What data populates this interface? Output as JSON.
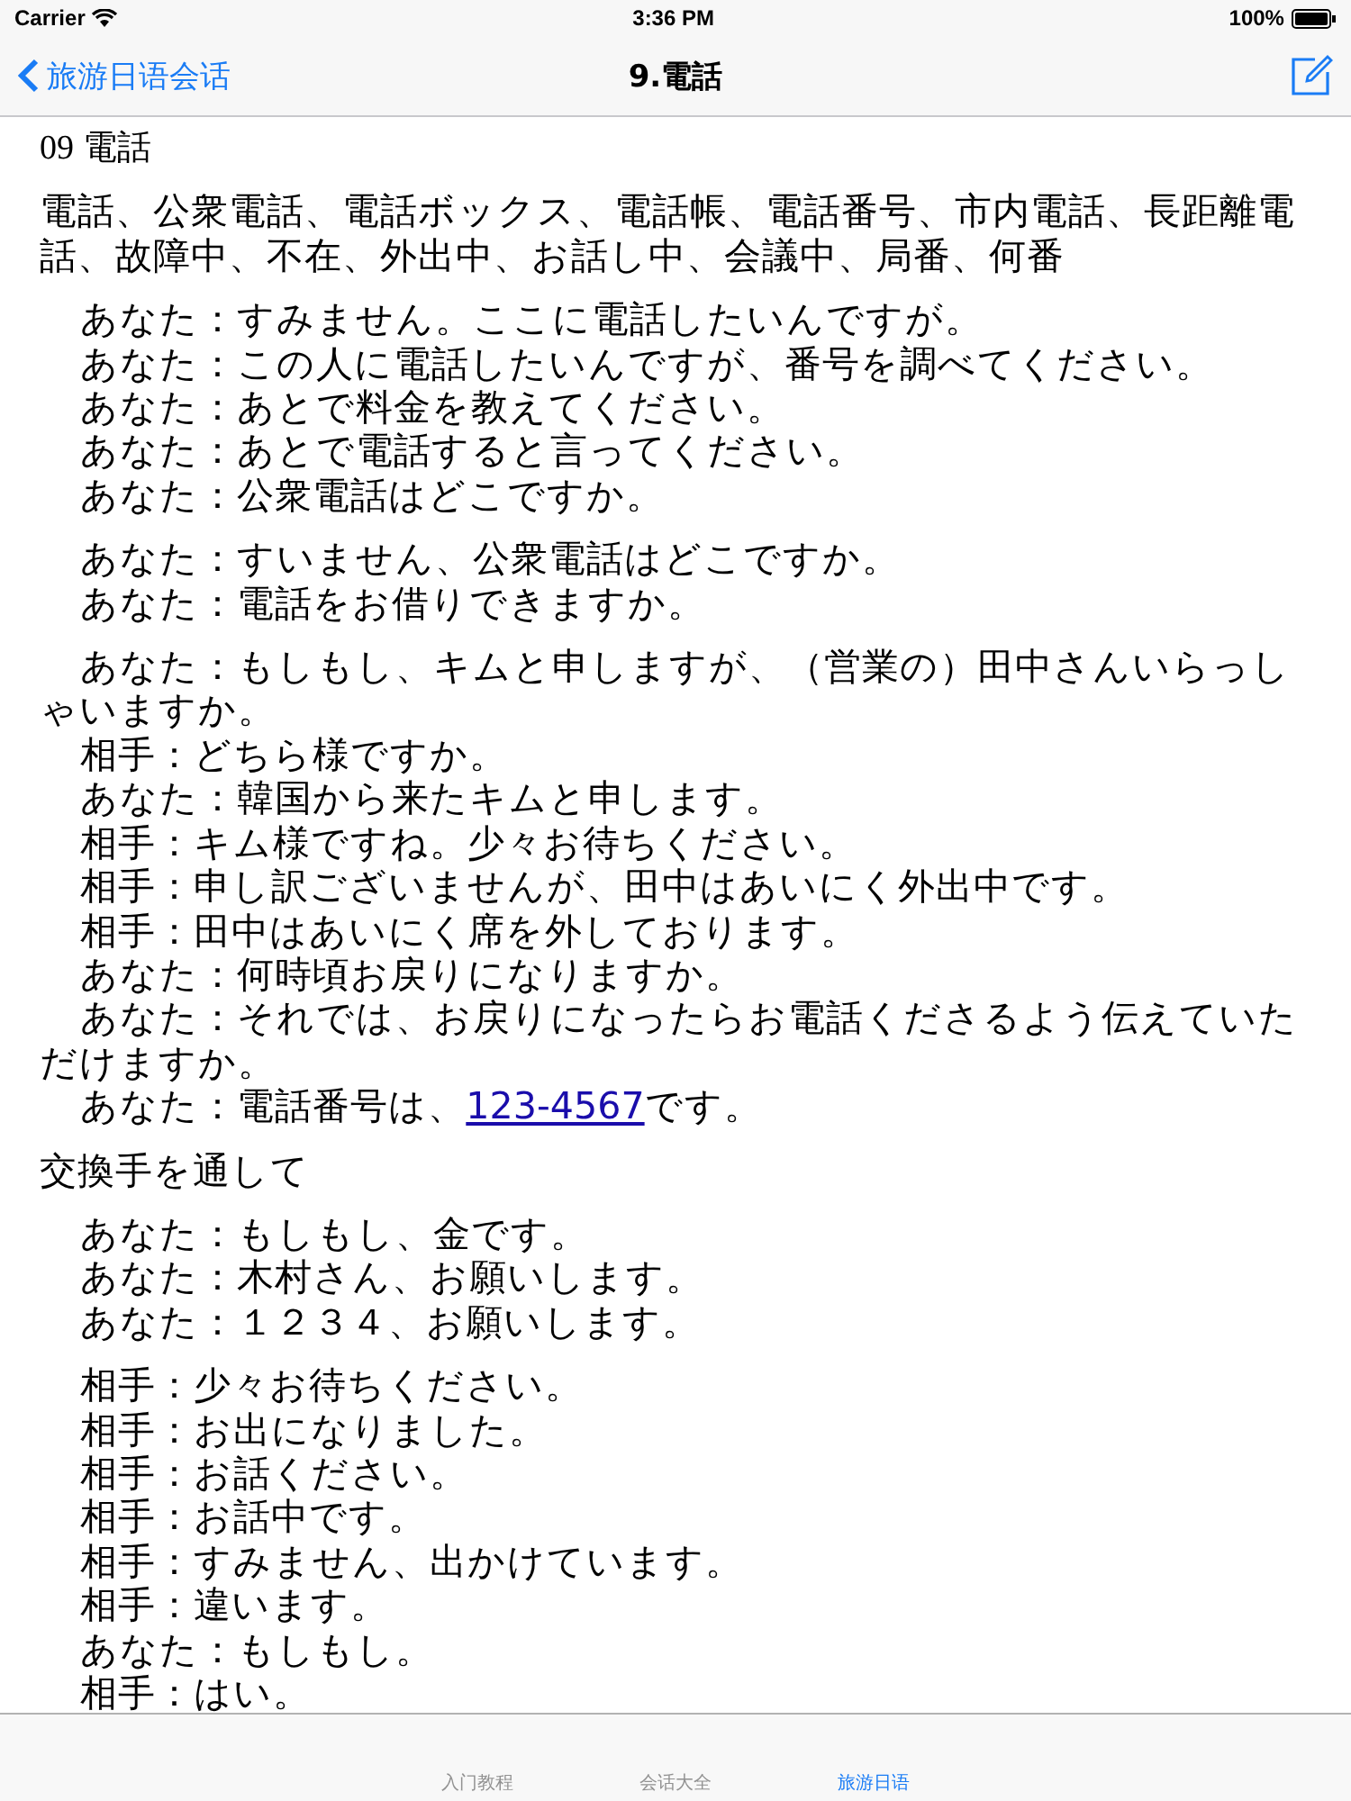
{
  "status_bar": {
    "carrier": "Carrier",
    "time": "3:36 PM",
    "battery": "100%"
  },
  "nav_bar": {
    "back": "旅游日语会话",
    "title": "9.電話"
  },
  "content": {
    "heading": "09 電話",
    "blocks": [
      {
        "kind": "plain",
        "lines": [
          "電話、公衆電話、電話ボックス、電話帳、電話番号、市内電話、長距離電話、故障中、不在、外出中、お話し中、会議中、局番、何番"
        ]
      },
      {
        "kind": "dialogue",
        "lines": [
          "あなた：すみません。ここに電話したいんですが。",
          "あなた：この人に電話したいんですが、番号を調べてください。",
          "あなた：あとで料金を教えてください。",
          "あなた：あとで電話すると言ってください。",
          "あなた：公衆電話はどこですか。"
        ]
      },
      {
        "kind": "dialogue",
        "lines": [
          "あなた：すいません、公衆電話はどこですか。",
          "あなた：電話をお借りできますか。"
        ]
      },
      {
        "kind": "dialogue",
        "lines": [
          "あなた：もしもし、キムと申しますが、（営業の）田中さんいらっしゃいますか。",
          "相手：どちら様ですか。",
          "あなた：韓国から来たキムと申します。",
          "相手：キム様ですね。少々お待ちください。",
          "相手：申し訳ございませんが、田中はあいにく外出中です。",
          "相手：田中はあいにく席を外しております。",
          "あなた：何時頃お戻りになりますか。",
          "あなた：それでは、お戻りになったらお電話くださるよう伝えていただけますか。",
          {
            "text": "あなた：電話番号は、",
            "link": "123-4567",
            "after": "です。"
          }
        ]
      },
      {
        "kind": "plain",
        "lines": [
          "交換手を通して"
        ]
      },
      {
        "kind": "dialogue",
        "lines": [
          "あなた：もしもし、金です。",
          "あなた：木村さん、お願いします。",
          "あなた：１２３４、お願いします。"
        ]
      },
      {
        "kind": "dialogue",
        "lines": [
          "相手：少々お待ちください。",
          "相手：お出になりました。",
          "相手：お話ください。",
          "相手：お話中です。",
          "相手：すみません、出かけています。",
          "相手：違います。",
          "あなた：もしもし。",
          "相手：はい。"
        ]
      }
    ]
  },
  "tab_bar": [
    {
      "label": "入门教程",
      "selected": false
    },
    {
      "label": "会话大全",
      "selected": false
    },
    {
      "label": "旅游日语",
      "selected": true
    }
  ]
}
